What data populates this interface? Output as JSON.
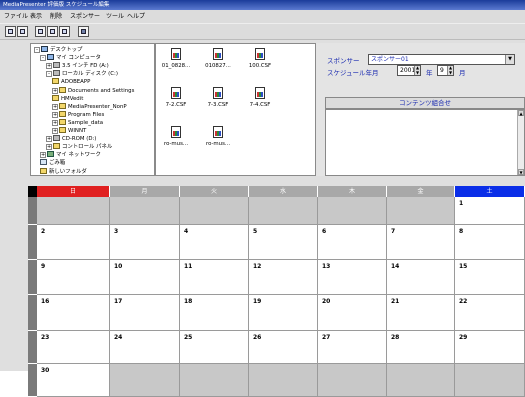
{
  "window": {
    "title": "MediaPresenter 評価版 スケジュール編集"
  },
  "menu": [
    "ファイル",
    "表示",
    "削除",
    "スポンサー",
    "ツール",
    "ヘルプ"
  ],
  "toolbar": {
    "icons": [
      "new-icon",
      "save-icon",
      "layout-icon-1",
      "layout-icon-2",
      "layout-icon-3",
      "preview-icon"
    ]
  },
  "tree": {
    "nodes": [
      {
        "label": "デスクトップ",
        "icon": "desktop",
        "depth": 0,
        "exp": "-"
      },
      {
        "label": "マイ コンピュータ",
        "icon": "pc",
        "depth": 1,
        "exp": "-"
      },
      {
        "label": "3.5 インチ FD (A:)",
        "icon": "drv",
        "depth": 2,
        "exp": "+"
      },
      {
        "label": "ローカル ディスク (C:)",
        "icon": "drv",
        "depth": 2,
        "exp": "-"
      },
      {
        "label": "ADOBEAPP",
        "icon": "folder",
        "depth": 3,
        "exp": ""
      },
      {
        "label": "Documents and Settings",
        "icon": "folder",
        "depth": 3,
        "exp": "+"
      },
      {
        "label": "HMVedit",
        "icon": "folder",
        "depth": 3,
        "exp": ""
      },
      {
        "label": "MediaPresenter_NonP",
        "icon": "folder",
        "depth": 3,
        "exp": "+"
      },
      {
        "label": "Program Files",
        "icon": "folder",
        "depth": 3,
        "exp": "+"
      },
      {
        "label": "Sample_data",
        "icon": "folder",
        "depth": 3,
        "exp": "+"
      },
      {
        "label": "WINNT",
        "icon": "folder",
        "depth": 3,
        "exp": "+"
      },
      {
        "label": "CD-ROM (D:)",
        "icon": "drv",
        "depth": 2,
        "exp": "+"
      },
      {
        "label": "コントロール パネル",
        "icon": "folder",
        "depth": 2,
        "exp": "+"
      },
      {
        "label": "マイ ネットワーク",
        "icon": "net",
        "depth": 1,
        "exp": "+"
      },
      {
        "label": "ごみ箱",
        "icon": "bin",
        "depth": 1,
        "exp": ""
      },
      {
        "label": "新しいフォルダ",
        "icon": "folder",
        "depth": 1,
        "exp": ""
      }
    ]
  },
  "files": [
    "01_0828...",
    "010827...",
    "100.CSF",
    "7-2.CSF",
    "7-3.CSF",
    "7-4.CSF",
    "ro-mus...",
    "ro-mus..."
  ],
  "schedule": {
    "sponsor_label": "スポンサー",
    "sponsor_value": "スポンサー01",
    "date_label": "スケジュール年月",
    "year": "2001",
    "year_unit": "年",
    "month": "9",
    "month_unit": "月",
    "content_header": "コンテンツ組合せ"
  },
  "calendar": {
    "weekdays": [
      "日",
      "月",
      "火",
      "水",
      "木",
      "金",
      "土"
    ],
    "weeks": [
      [
        "",
        "",
        "",
        "",
        "",
        "",
        "1"
      ],
      [
        "2",
        "3",
        "4",
        "5",
        "6",
        "7",
        "8"
      ],
      [
        "9",
        "10",
        "11",
        "12",
        "13",
        "14",
        "15"
      ],
      [
        "16",
        "17",
        "18",
        "19",
        "20",
        "21",
        "22"
      ],
      [
        "23",
        "24",
        "25",
        "26",
        "27",
        "28",
        "29"
      ],
      [
        "30",
        "",
        "",
        "",
        "",
        "",
        ""
      ]
    ],
    "colors": {
      "sunday": "#e02020",
      "saturday": "#0a2ee8",
      "weekday": "#a8a8a8"
    }
  }
}
